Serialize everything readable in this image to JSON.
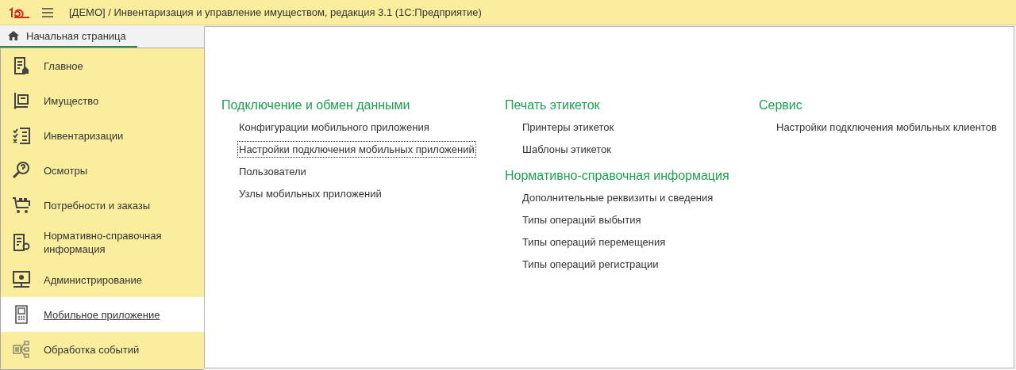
{
  "window": {
    "title": "[ДЕМО] / Инвентаризация и управление имуществом, редакция 3.1  (1С:Предприятие)"
  },
  "tabs": [
    {
      "label": "Начальная страница",
      "selected": true
    }
  ],
  "sidebar": {
    "items": [
      {
        "label": "Главное",
        "selected": false
      },
      {
        "label": "Имущество",
        "selected": false
      },
      {
        "label": "Инвентаризации",
        "selected": false
      },
      {
        "label": "Осмотры",
        "selected": false
      },
      {
        "label": "Потребности и заказы",
        "selected": false
      },
      {
        "label": "Нормативно-справочная информация",
        "selected": false
      },
      {
        "label": "Администрирование",
        "selected": false
      },
      {
        "label": "Мобильное приложение",
        "selected": true
      },
      {
        "label": "Обработка событий",
        "selected": false
      }
    ]
  },
  "columns": [
    {
      "sections": [
        {
          "title": "Подключение и обмен данными",
          "links": [
            {
              "label": "Конфигурации мобильного приложения",
              "focused": false
            },
            {
              "label": "Настройки подключения мобильных приложений",
              "focused": true
            },
            {
              "label": "Пользователи",
              "focused": false
            },
            {
              "label": "Узлы мобильных приложений",
              "focused": false
            }
          ]
        }
      ]
    },
    {
      "sections": [
        {
          "title": "Печать этикеток",
          "links": [
            {
              "label": "Принтеры этикеток",
              "focused": false
            },
            {
              "label": "Шаблоны этикеток",
              "focused": false
            }
          ]
        },
        {
          "title": "Нормативно-справочная информация",
          "links": [
            {
              "label": "Дополнительные реквизиты и сведения",
              "focused": false
            },
            {
              "label": "Типы операций выбытия",
              "focused": false
            },
            {
              "label": "Типы операций перемещения",
              "focused": false
            },
            {
              "label": "Типы операций регистрации",
              "focused": false
            }
          ]
        }
      ]
    },
    {
      "sections": [
        {
          "title": "Сервис",
          "links": [
            {
              "label": "Настройки подключения мобильных клиентов",
              "focused": false
            }
          ]
        }
      ]
    }
  ]
}
